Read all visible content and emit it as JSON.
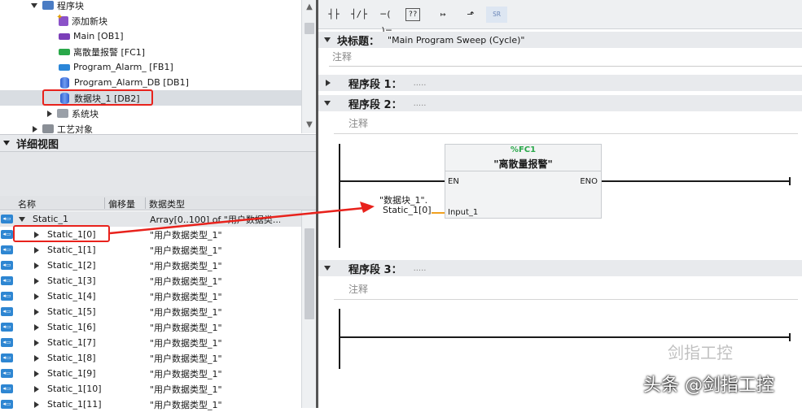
{
  "tree": {
    "items": [
      {
        "label": "程序块"
      },
      {
        "label": "添加新块"
      },
      {
        "label": "Main [OB1]"
      },
      {
        "label": "离散量报警 [FC1]"
      },
      {
        "label": "Program_Alarm_ [FB1]"
      },
      {
        "label": "Program_Alarm_DB [DB1]"
      },
      {
        "label": "数据块_1 [DB2]"
      },
      {
        "label": "系统块"
      },
      {
        "label": "工艺对象"
      }
    ]
  },
  "detail": {
    "title": "详细视图",
    "columns": {
      "name": "名称",
      "offset": "偏移量",
      "type": "数据类型"
    },
    "parent": {
      "name": "Static_1",
      "type": "Array[0..100] of \"用户数据类..."
    },
    "rows": [
      {
        "name": "Static_1[0]",
        "type": "\"用户数据类型_1\""
      },
      {
        "name": "Static_1[1]",
        "type": "\"用户数据类型_1\""
      },
      {
        "name": "Static_1[2]",
        "type": "\"用户数据类型_1\""
      },
      {
        "name": "Static_1[3]",
        "type": "\"用户数据类型_1\""
      },
      {
        "name": "Static_1[4]",
        "type": "\"用户数据类型_1\""
      },
      {
        "name": "Static_1[5]",
        "type": "\"用户数据类型_1\""
      },
      {
        "name": "Static_1[6]",
        "type": "\"用户数据类型_1\""
      },
      {
        "name": "Static_1[7]",
        "type": "\"用户数据类型_1\""
      },
      {
        "name": "Static_1[8]",
        "type": "\"用户数据类型_1\""
      },
      {
        "name": "Static_1[9]",
        "type": "\"用户数据类型_1\""
      },
      {
        "name": "Static_1[10]",
        "type": "\"用户数据类型_1\""
      },
      {
        "name": "Static_1[11]",
        "type": "\"用户数据类型_1\""
      }
    ]
  },
  "toolbar": {
    "sr_label": "SR"
  },
  "editor": {
    "block_title_label": "块标题：",
    "block_title_value": "\"Main Program Sweep (Cycle)\"",
    "comment": "注释",
    "networks": [
      {
        "label": "程序段 1：",
        "dots": "....."
      },
      {
        "label": "程序段 2：",
        "dots": "....."
      },
      {
        "label": "程序段 3：",
        "dots": "....."
      }
    ],
    "fb": {
      "number": "%FC1",
      "name": "\"离散量报警\"",
      "en": "EN",
      "eno": "ENO",
      "input": "Input_1",
      "operand_line1": "\"数据块_1\".",
      "operand_line2": "Static_1[0]"
    }
  },
  "watermark": {
    "text": "头条 @剑指工控",
    "faint": "剑指工控"
  },
  "colors": {
    "highlight_red": "#e8221c",
    "accent_orange": "#f0a020",
    "fc_green": "#2aa84a"
  }
}
